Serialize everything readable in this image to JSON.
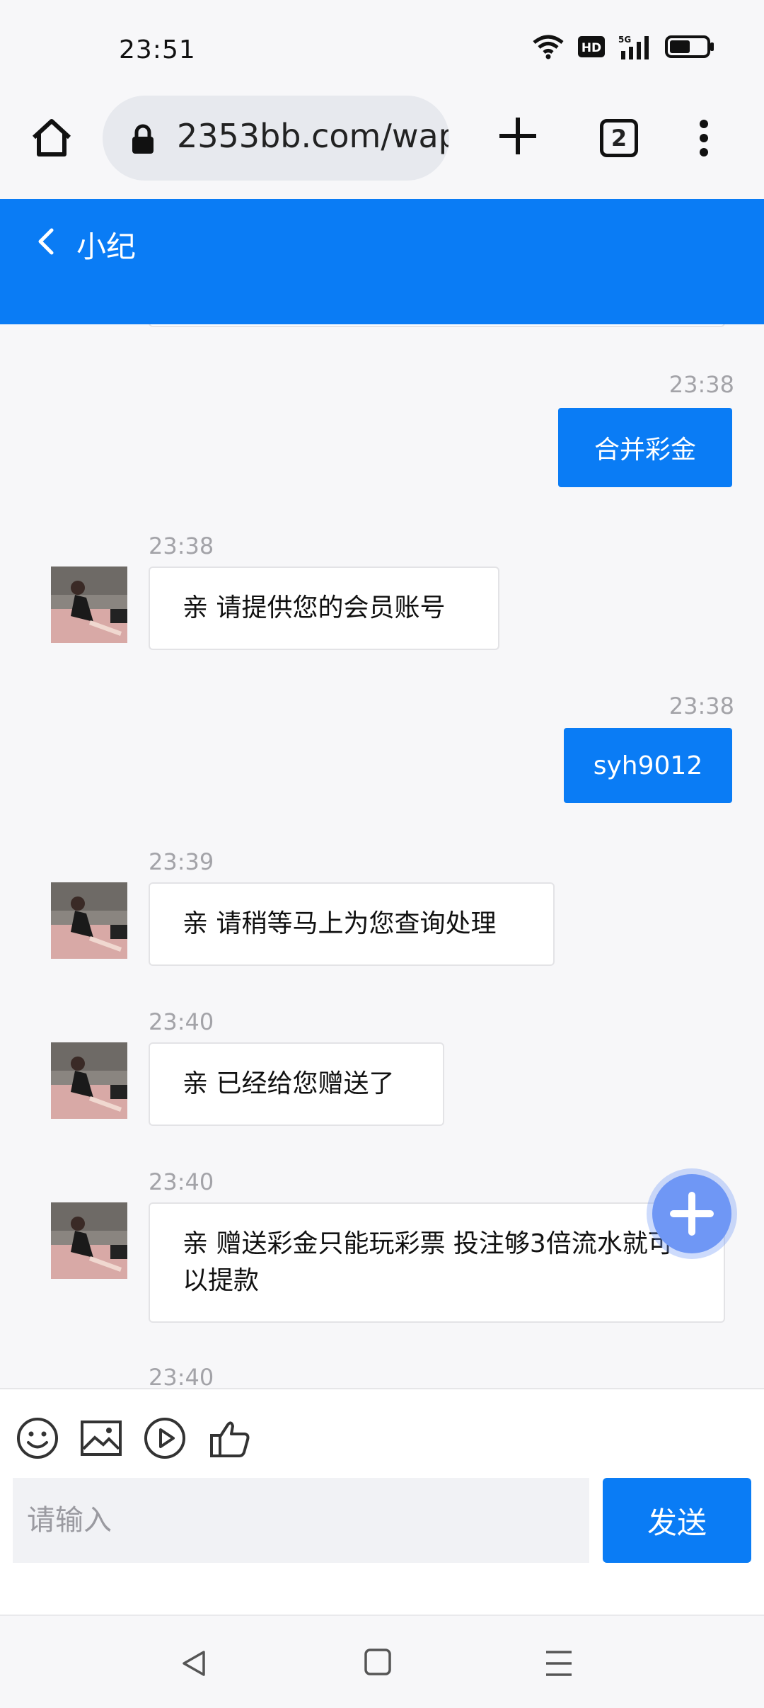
{
  "status_bar": {
    "time": "23:51",
    "battery_level": 0.55
  },
  "browser": {
    "url": "2353bb.com/wap",
    "tab_count": "2"
  },
  "header": {
    "title": "小纪"
  },
  "messages": [
    {
      "side": "out",
      "time": "23:38",
      "text": "合并彩金"
    },
    {
      "side": "in",
      "time": "23:38",
      "text": "亲 请提供您的会员账号"
    },
    {
      "side": "out",
      "time": "23:38",
      "text": "syh9012"
    },
    {
      "side": "in",
      "time": "23:39",
      "text": "亲 请稍等马上为您查询处理"
    },
    {
      "side": "in",
      "time": "23:40",
      "text": "亲 已经给您赠送了"
    },
    {
      "side": "in",
      "time": "23:40",
      "text": "亲 赠送彩金只能玩彩票 投注够3倍流水就可以提款"
    },
    {
      "side": "in",
      "time": "23:40",
      "text": ""
    }
  ],
  "input": {
    "placeholder": "请输入",
    "send_label": "发送"
  },
  "colors": {
    "accent": "#0a7cf5",
    "fab": "#6f97f5",
    "background": "#f7f7f9"
  },
  "icons": [
    "home-icon",
    "lock-icon",
    "plus-icon",
    "tabs-icon",
    "more-icon",
    "back-icon",
    "emoji-icon",
    "image-icon",
    "video-icon",
    "thumbs-up-icon",
    "nav-back-icon",
    "nav-home-icon",
    "nav-menu-icon",
    "wifi-icon",
    "hd-icon",
    "signal-icon",
    "battery-icon"
  ]
}
